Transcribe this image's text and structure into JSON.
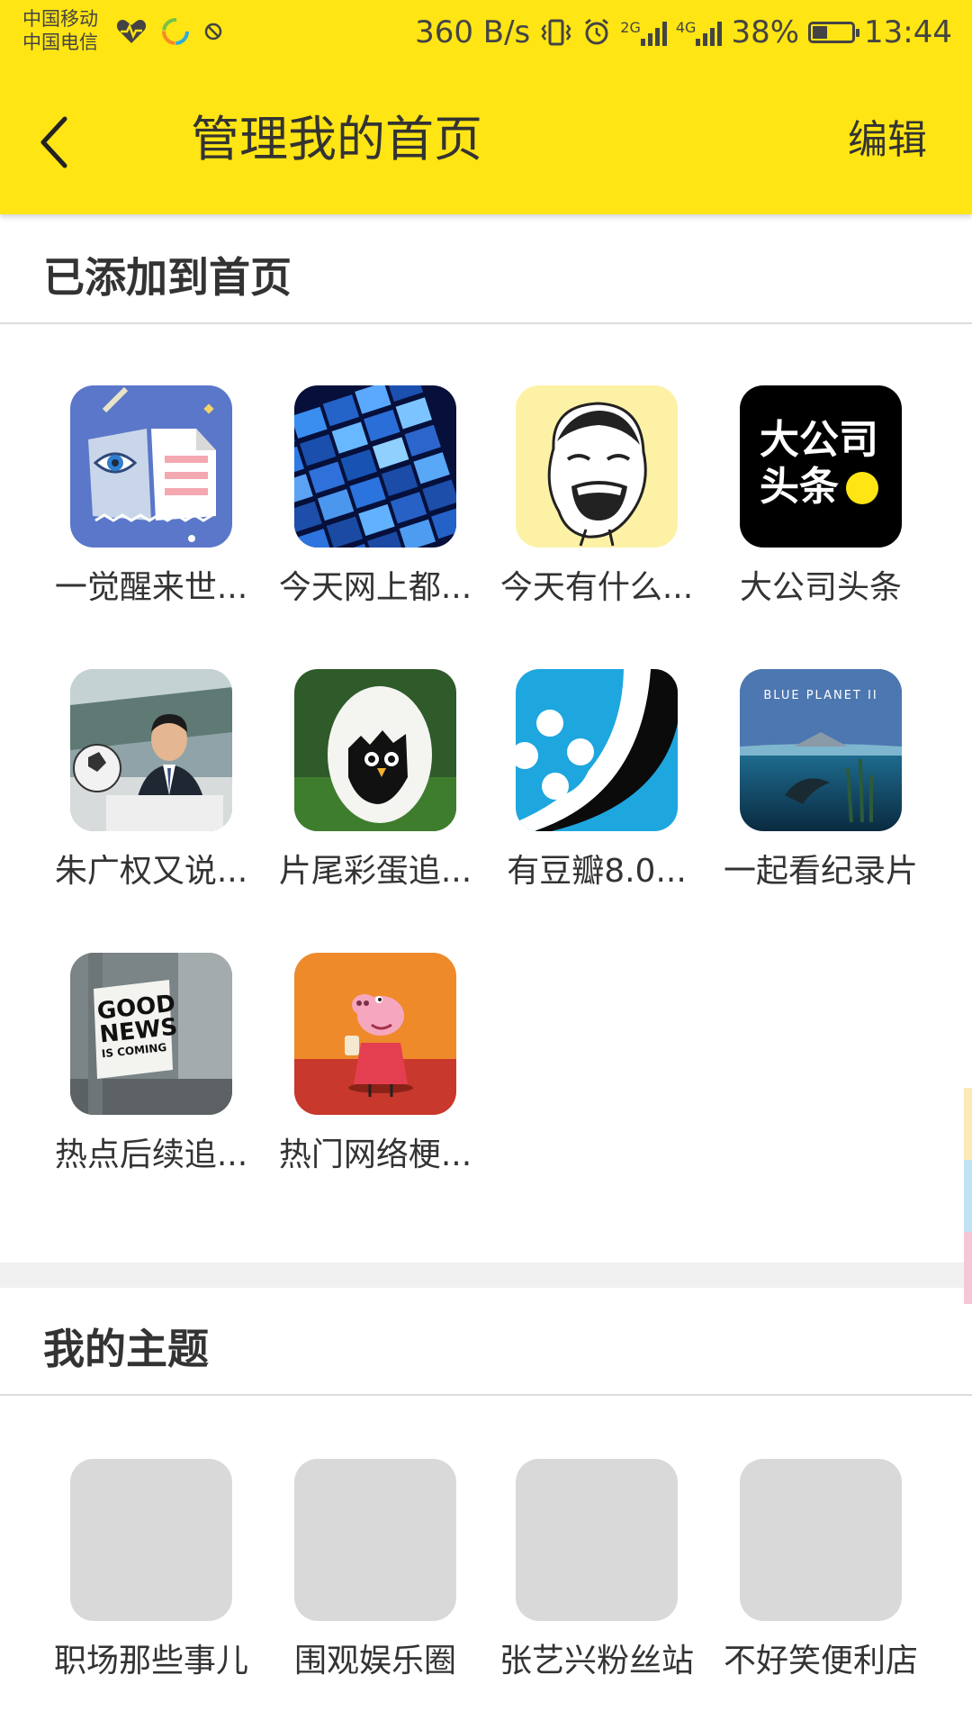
{
  "status_bar": {
    "carrier1": "中国移动",
    "carrier2": "中国电信",
    "net_speed": "360 B/s",
    "sim1_tech": "2G",
    "sim2_tech": "4G",
    "battery": "38%",
    "battery_level": 0.38,
    "time": "13:44",
    "icons": [
      "heart-health-icon",
      "ring-app-icon",
      "blocked-icon",
      "vibrate-icon",
      "alarm-icon",
      "signal-icon",
      "battery-icon"
    ]
  },
  "header": {
    "title": "管理我的首页",
    "edit_label": "编辑",
    "back_icon": "chevron-left-icon",
    "background": "#FFE513"
  },
  "added_section": {
    "title": "已添加到首页",
    "items": [
      {
        "label": "一觉醒来世...",
        "icon": "open-book-eye-icon"
      },
      {
        "label": "今天网上都...",
        "icon": "news-screens-icon"
      },
      {
        "label": "今天有什么...",
        "icon": "laughing-meme-face-icon"
      },
      {
        "label": "大公司头条",
        "icon": "big-company-headlines-logo"
      },
      {
        "label": "朱广权又说...",
        "icon": "news-anchor-photo"
      },
      {
        "label": "片尾彩蛋追...",
        "icon": "egg-with-chick-icon"
      },
      {
        "label": "有豆瓣8.0...",
        "icon": "film-reel-icon"
      },
      {
        "label": "一起看纪录片",
        "icon": "blue-planet-ocean-photo"
      },
      {
        "label": "热点后续追...",
        "icon": "good-news-poster-photo"
      },
      {
        "label": "热门网络梗...",
        "icon": "peppa-pig-icon"
      }
    ],
    "logo_text_line1": "大公司",
    "logo_text_line2": "头条",
    "good_news_lines": [
      "GOOD",
      "NEWS",
      "IS COMING"
    ],
    "blue_planet_text": "BLUE PLANET II"
  },
  "themes_section": {
    "title": "我的主题",
    "items": [
      {
        "label": "职场那些事儿"
      },
      {
        "label": "围观娱乐圈"
      },
      {
        "label": "张艺兴粉丝站"
      },
      {
        "label": "不好笑便利店"
      }
    ]
  }
}
